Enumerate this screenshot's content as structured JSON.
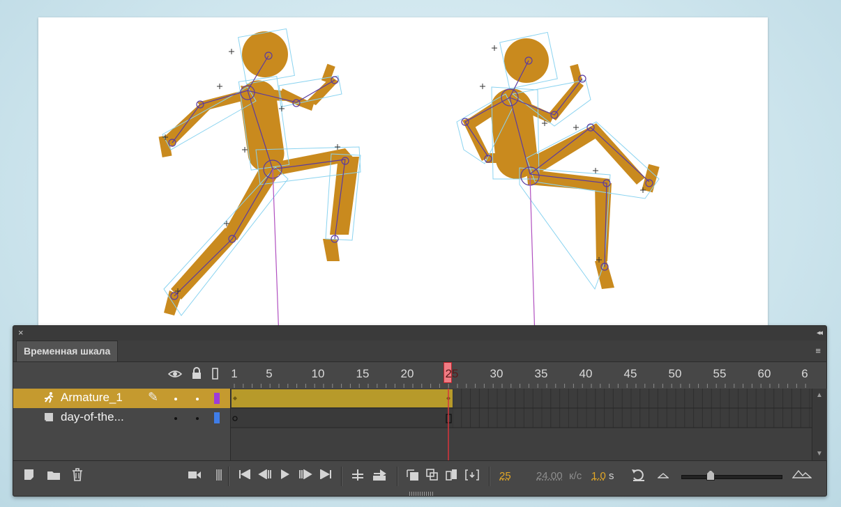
{
  "panel": {
    "tab_label": "Временная шкала",
    "close_glyph": "×",
    "collapse_glyph": "◂◂",
    "menu_glyph": "≡"
  },
  "header_icons": [
    "eye-icon",
    "lock-icon",
    "outline-icon"
  ],
  "ruler": {
    "ticks": [
      "1",
      "5",
      "10",
      "15",
      "20",
      "25",
      "30",
      "35",
      "40",
      "45",
      "50",
      "55",
      "60",
      "6"
    ],
    "current_frame": "25"
  },
  "layers": [
    {
      "name": "Armature_1",
      "icon": "armature-runner-icon",
      "selected": true,
      "color": "#9d3bd9"
    },
    {
      "name": "day-of-the...",
      "icon": "layer-page-icon",
      "selected": false,
      "color": "#3f7de8"
    }
  ],
  "status": {
    "frame": "25",
    "fps": "24.00",
    "fps_unit": "к/с",
    "elapsed": "1.0",
    "elapsed_unit": "s"
  },
  "colors": {
    "accent": "#e0a627",
    "playhead": "#d9343c",
    "figure": "#c98a1e",
    "span_fill": "#b79a2a"
  }
}
